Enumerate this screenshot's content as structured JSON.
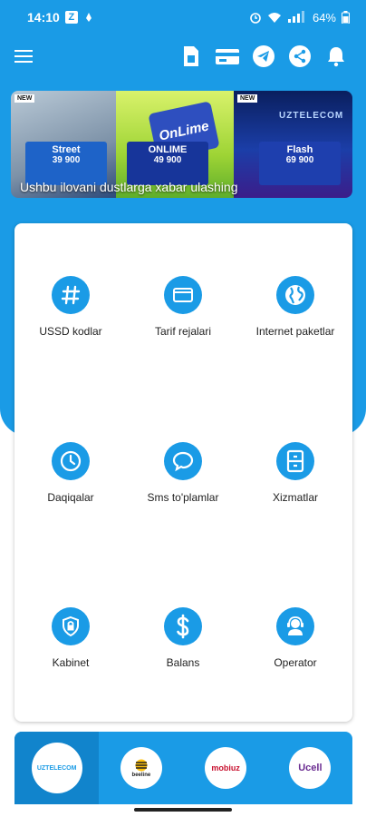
{
  "status_bar": {
    "time": "14:10",
    "indicator": "Z",
    "battery": "64%"
  },
  "toolbar": {
    "icons": [
      "menu-icon",
      "sim-card-icon",
      "tariff-card-icon",
      "telegram-icon",
      "share-icon",
      "bell-icon"
    ]
  },
  "banner": {
    "caption": "Ushbu ilovani dustlarga xabar ulashing",
    "slides": [
      {
        "tag": "NEW",
        "name": "Street",
        "price": "39 900"
      },
      {
        "badge": "OnLime",
        "name": "ONLIME",
        "price": "49 900"
      },
      {
        "tag": "NEW",
        "brand": "UZTELECOM",
        "name": "Flash",
        "price": "69 900"
      }
    ]
  },
  "menu_grid": {
    "items": [
      {
        "label": "USSD kodlar",
        "icon": "hash-icon"
      },
      {
        "label": "Tarif rejalari",
        "icon": "card-icon"
      },
      {
        "label": "Internet paketlar",
        "icon": "globe-icon"
      },
      {
        "label": "Daqiqalar",
        "icon": "clock-icon"
      },
      {
        "label": "Sms to'plamlar",
        "icon": "chat-bubble-icon"
      },
      {
        "label": "Xizmatlar",
        "icon": "cabinet-icon"
      },
      {
        "label": "Kabinet",
        "icon": "lock-shield-icon"
      },
      {
        "label": "Balans",
        "icon": "dollar-icon"
      },
      {
        "label": "Operator",
        "icon": "headset-operator-icon"
      }
    ]
  },
  "operators": [
    {
      "label": "UZTELECOM",
      "color": "#1a9be6",
      "active": true
    },
    {
      "label": "beeline",
      "color": "#222222",
      "active": false
    },
    {
      "label": "mobiuz",
      "color": "#c8102e",
      "active": false
    },
    {
      "label": "Ucell",
      "color": "#6a2c91",
      "active": false
    }
  ],
  "colors": {
    "primary": "#1a9be6",
    "primary_dark": "#1184cc",
    "card_bg": "#ffffff"
  }
}
